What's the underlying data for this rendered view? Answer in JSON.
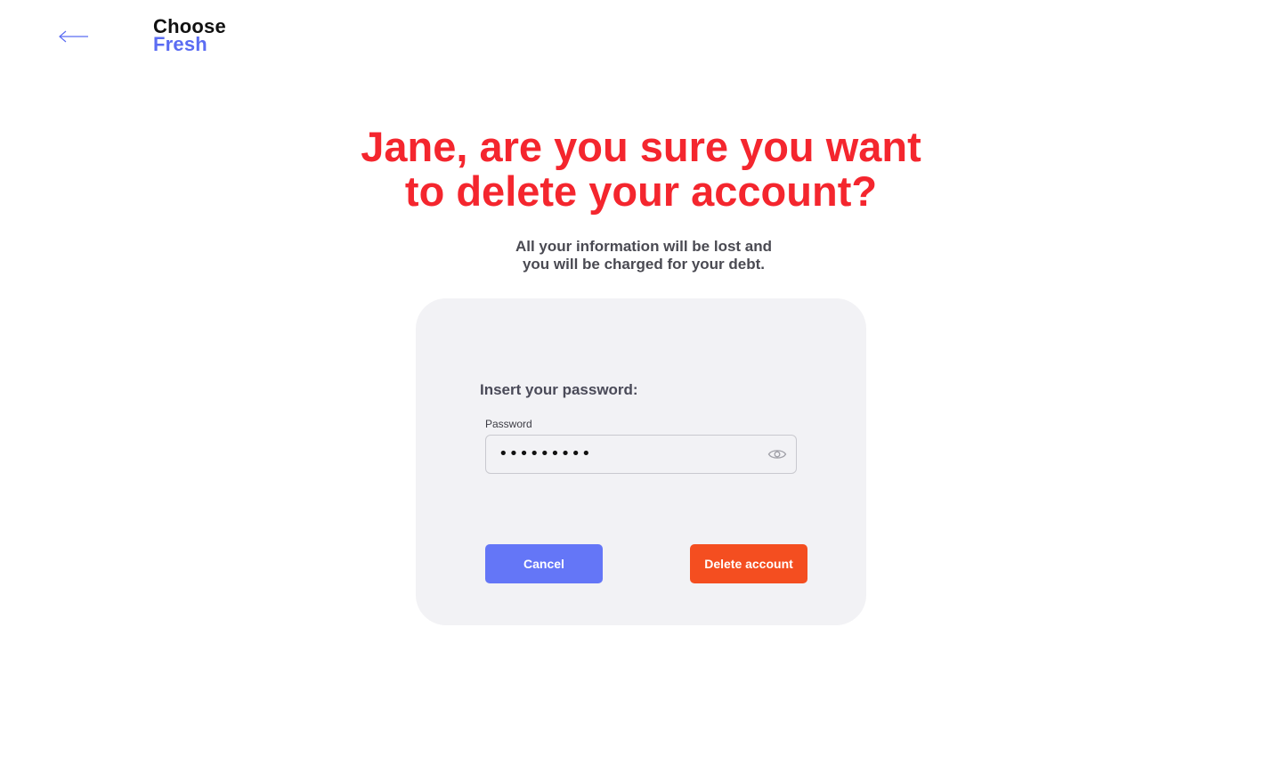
{
  "header": {
    "back_icon": "arrow-left-icon",
    "logo_line1": "Choose",
    "logo_line2": "Fresh"
  },
  "dialog": {
    "title_line1": "Jane, are you sure you want",
    "title_line2": "to delete your account?",
    "subtitle_line1": "All your information will be lost and",
    "subtitle_line2": "you will be charged for your debt."
  },
  "form": {
    "prompt": "Insert your password:",
    "password_label": "Password",
    "password_value": "•••••••••",
    "visibility_icon": "eye-icon"
  },
  "actions": {
    "cancel_label": "Cancel",
    "delete_label": "Delete account"
  },
  "colors": {
    "title": "#f4262e",
    "brand_accent": "#5b6cf2",
    "cancel_button": "#6476f7",
    "delete_button": "#f44e20",
    "card_background": "#f2f2f5"
  }
}
